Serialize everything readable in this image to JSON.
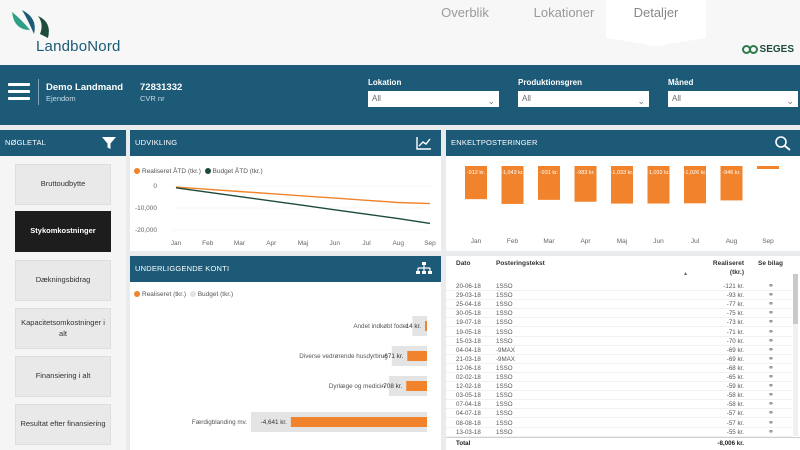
{
  "app": {
    "logo_text": "LandboNord",
    "partner": "SEGES"
  },
  "tabs": [
    {
      "label": "Overblik"
    },
    {
      "label": "Lokationer"
    },
    {
      "label": "Detaljer"
    }
  ],
  "farm": {
    "name": "Demo Landmand",
    "type": "Ejendom",
    "cvr": "72831332",
    "cvr_label": "CVR nr"
  },
  "filters": {
    "lokation": {
      "label": "Lokation",
      "value": "All"
    },
    "produktionsgren": {
      "label": "Produktionsgren",
      "value": "All"
    },
    "maaned": {
      "label": "Måned",
      "value": "All"
    }
  },
  "noegletal": {
    "title": "NØGLETAL",
    "items": [
      {
        "label": "Bruttoudbytte",
        "active": false
      },
      {
        "label": "Stykomkostninger",
        "active": true
      },
      {
        "label": "Dækningsbidrag",
        "active": false
      },
      {
        "label": "Kapacitetsomkostninger i alt",
        "active": false
      },
      {
        "label": "Finansiering i alt",
        "active": false
      },
      {
        "label": "Resultat efter finansiering",
        "active": false
      }
    ]
  },
  "udvikling": {
    "title": "UDVIKLING",
    "legend": [
      "Realiseret ÅTD (tkr.)",
      "Budget ÅTD (tkr.)"
    ],
    "colors": {
      "realiseret": "#f0832c",
      "budget": "#1d4b3a"
    }
  },
  "enkelt": {
    "title": "ENKELTPOSTERINGER",
    "bar_color": "#f0832c"
  },
  "konti": {
    "title": "UNDERLIGGENDE KONTI",
    "legend": [
      "Realiseret (tkr.)",
      "Budget (tkr.)"
    ],
    "rows": [
      {
        "label": "Andet indkøbt foder",
        "value": "-14 kr."
      },
      {
        "label": "Diverse vedrørende husdyrbrug",
        "value": "-671 kr."
      },
      {
        "label": "Dyrlæge og medicin",
        "value": "-708 kr."
      },
      {
        "label": "Færdigblanding mv.",
        "value": "-4,641 kr."
      }
    ]
  },
  "chart_data": [
    {
      "type": "line",
      "x": [
        "Jan",
        "Feb",
        "Mar",
        "Apr",
        "Maj",
        "Jun",
        "Jul",
        "Aug",
        "Sep"
      ],
      "series": [
        {
          "name": "Realiseret ÅTD (tkr.)",
          "values": [
            -500,
            -1500,
            -2500,
            -3500,
            -4500,
            -5500,
            -6500,
            -7500,
            -8000
          ]
        },
        {
          "name": "Budget ÅTD (tkr.)",
          "values": [
            -800,
            -2800,
            -4800,
            -6800,
            -8800,
            -10800,
            -12800,
            -14800,
            -17000
          ]
        }
      ],
      "ylabel": "",
      "yticks": [
        "0",
        "-10,000",
        "-20,000"
      ],
      "ylim": [
        -20000,
        0
      ],
      "legend": "top-left"
    },
    {
      "type": "bar",
      "categories": [
        "Jan",
        "Feb",
        "Mar",
        "Apr",
        "Maj",
        "Jun",
        "Jul",
        "Aug",
        "Sep"
      ],
      "values": [
        -912,
        -1043,
        -931,
        -983,
        -1033,
        -1032,
        -1026,
        -946,
        -50
      ],
      "labels": [
        "-912 kr.",
        "-1,043 kr.",
        "-931 kr.",
        "-983 kr.",
        "-1,033 kr.",
        "-1,032 kr.",
        "-1,026 kr.",
        "-946 kr.",
        ""
      ]
    },
    {
      "type": "bar",
      "categories": [
        "Andet indkøbt foder",
        "Diverse vedrørende husdyrbrug",
        "Dyrlæge og medicin",
        "Færdigblanding mv."
      ],
      "values": [
        -14,
        -671,
        -708,
        -4641
      ],
      "budget": [
        -500,
        -1200,
        -1300,
        -6000
      ]
    }
  ],
  "table": {
    "headers": {
      "dato": "Dato",
      "tekst": "Posteringstekst",
      "realiseret": "Realiseret (tkr.)",
      "bilag": "Se bilag"
    },
    "rows": [
      {
        "dato": "20-06-18",
        "tekst": "1SSO",
        "value": "-121 kr."
      },
      {
        "dato": "29-03-18",
        "tekst": "1SSO",
        "value": "-93 kr."
      },
      {
        "dato": "25-04-18",
        "tekst": "1SSO",
        "value": "-77 kr."
      },
      {
        "dato": "30-05-18",
        "tekst": "1SSO",
        "value": "-75 kr."
      },
      {
        "dato": "19-07-18",
        "tekst": "1SSO",
        "value": "-73 kr."
      },
      {
        "dato": "19-05-18",
        "tekst": "1SSO",
        "value": "-71 kr."
      },
      {
        "dato": "15-03-18",
        "tekst": "1SSO",
        "value": "-70 kr."
      },
      {
        "dato": "04-04-18",
        "tekst": "-9MAX",
        "value": "-69 kr."
      },
      {
        "dato": "21-03-18",
        "tekst": "-9MAX",
        "value": "-69 kr."
      },
      {
        "dato": "12-06-18",
        "tekst": "1SSO",
        "value": "-68 kr."
      },
      {
        "dato": "02-02-18",
        "tekst": "1SSO",
        "value": "-65 kr."
      },
      {
        "dato": "12-02-18",
        "tekst": "1SSO",
        "value": "-59 kr."
      },
      {
        "dato": "03-05-18",
        "tekst": "1SSO",
        "value": "-58 kr."
      },
      {
        "dato": "07-04-18",
        "tekst": "1SSO",
        "value": "-58 kr."
      },
      {
        "dato": "04-07-18",
        "tekst": "1SSO",
        "value": "-57 kr."
      },
      {
        "dato": "08-08-18",
        "tekst": "1SSO",
        "value": "-57 kr."
      },
      {
        "dato": "13-03-18",
        "tekst": "1SSO",
        "value": "-55 kr."
      }
    ],
    "total_label": "Total",
    "total_value": "-8,006 kr."
  }
}
